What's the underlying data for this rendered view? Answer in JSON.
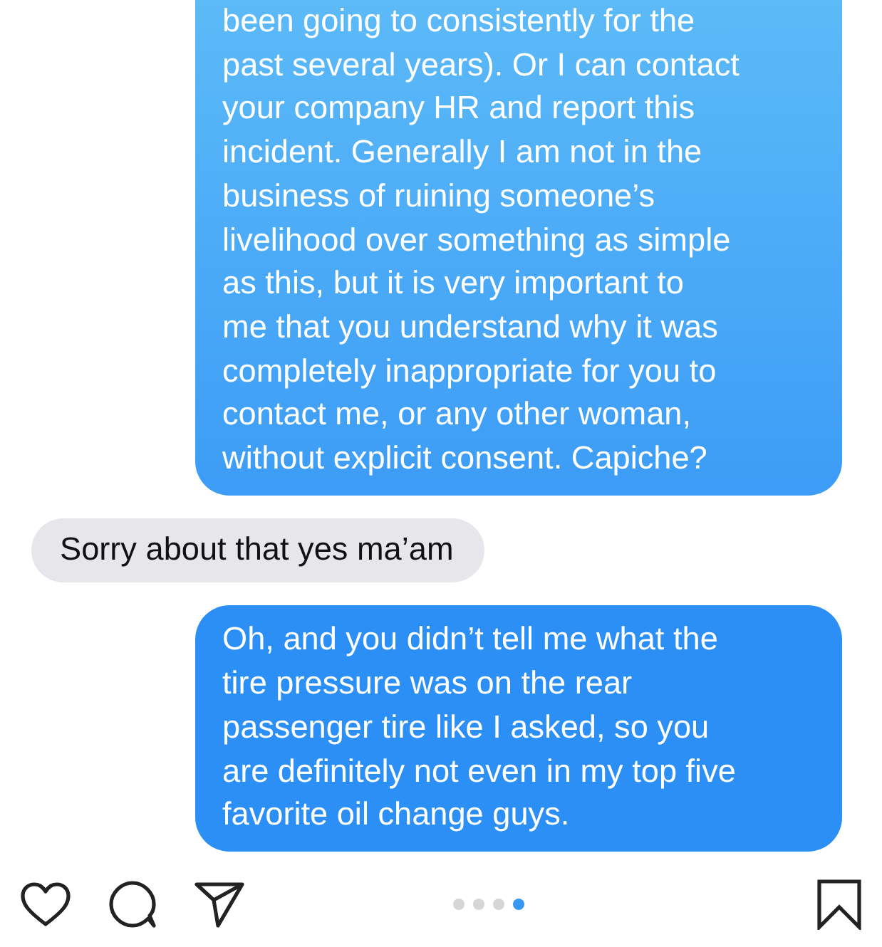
{
  "messages": [
    {
      "kind": "sent",
      "cut_top": true,
      "lines": [
        "been going to consistently for the",
        "past several years). Or I can contact",
        "your company HR and report this",
        "incident. Generally I am not in the",
        "business of ruining someone’s",
        "livelihood over something as simple",
        "as this, but it is very important to",
        "me that you understand why it was",
        "completely inappropriate for you to",
        "contact me, or any other woman,",
        "without explicit consent. Capiche?"
      ]
    },
    {
      "kind": "received",
      "cut_top": false,
      "lines": [
        "Sorry about that yes ma’am"
      ]
    },
    {
      "kind": "sent",
      "cut_top": false,
      "lines": [
        "Oh, and you didn’t tell me what the",
        "tire pressure was on the rear",
        "passenger tire like I asked, so you",
        "are definitely not even in my top five",
        "favorite oil change guys."
      ]
    }
  ],
  "page_dots": [
    {
      "selected": false
    },
    {
      "selected": false
    },
    {
      "selected": false
    },
    {
      "selected": true
    }
  ]
}
